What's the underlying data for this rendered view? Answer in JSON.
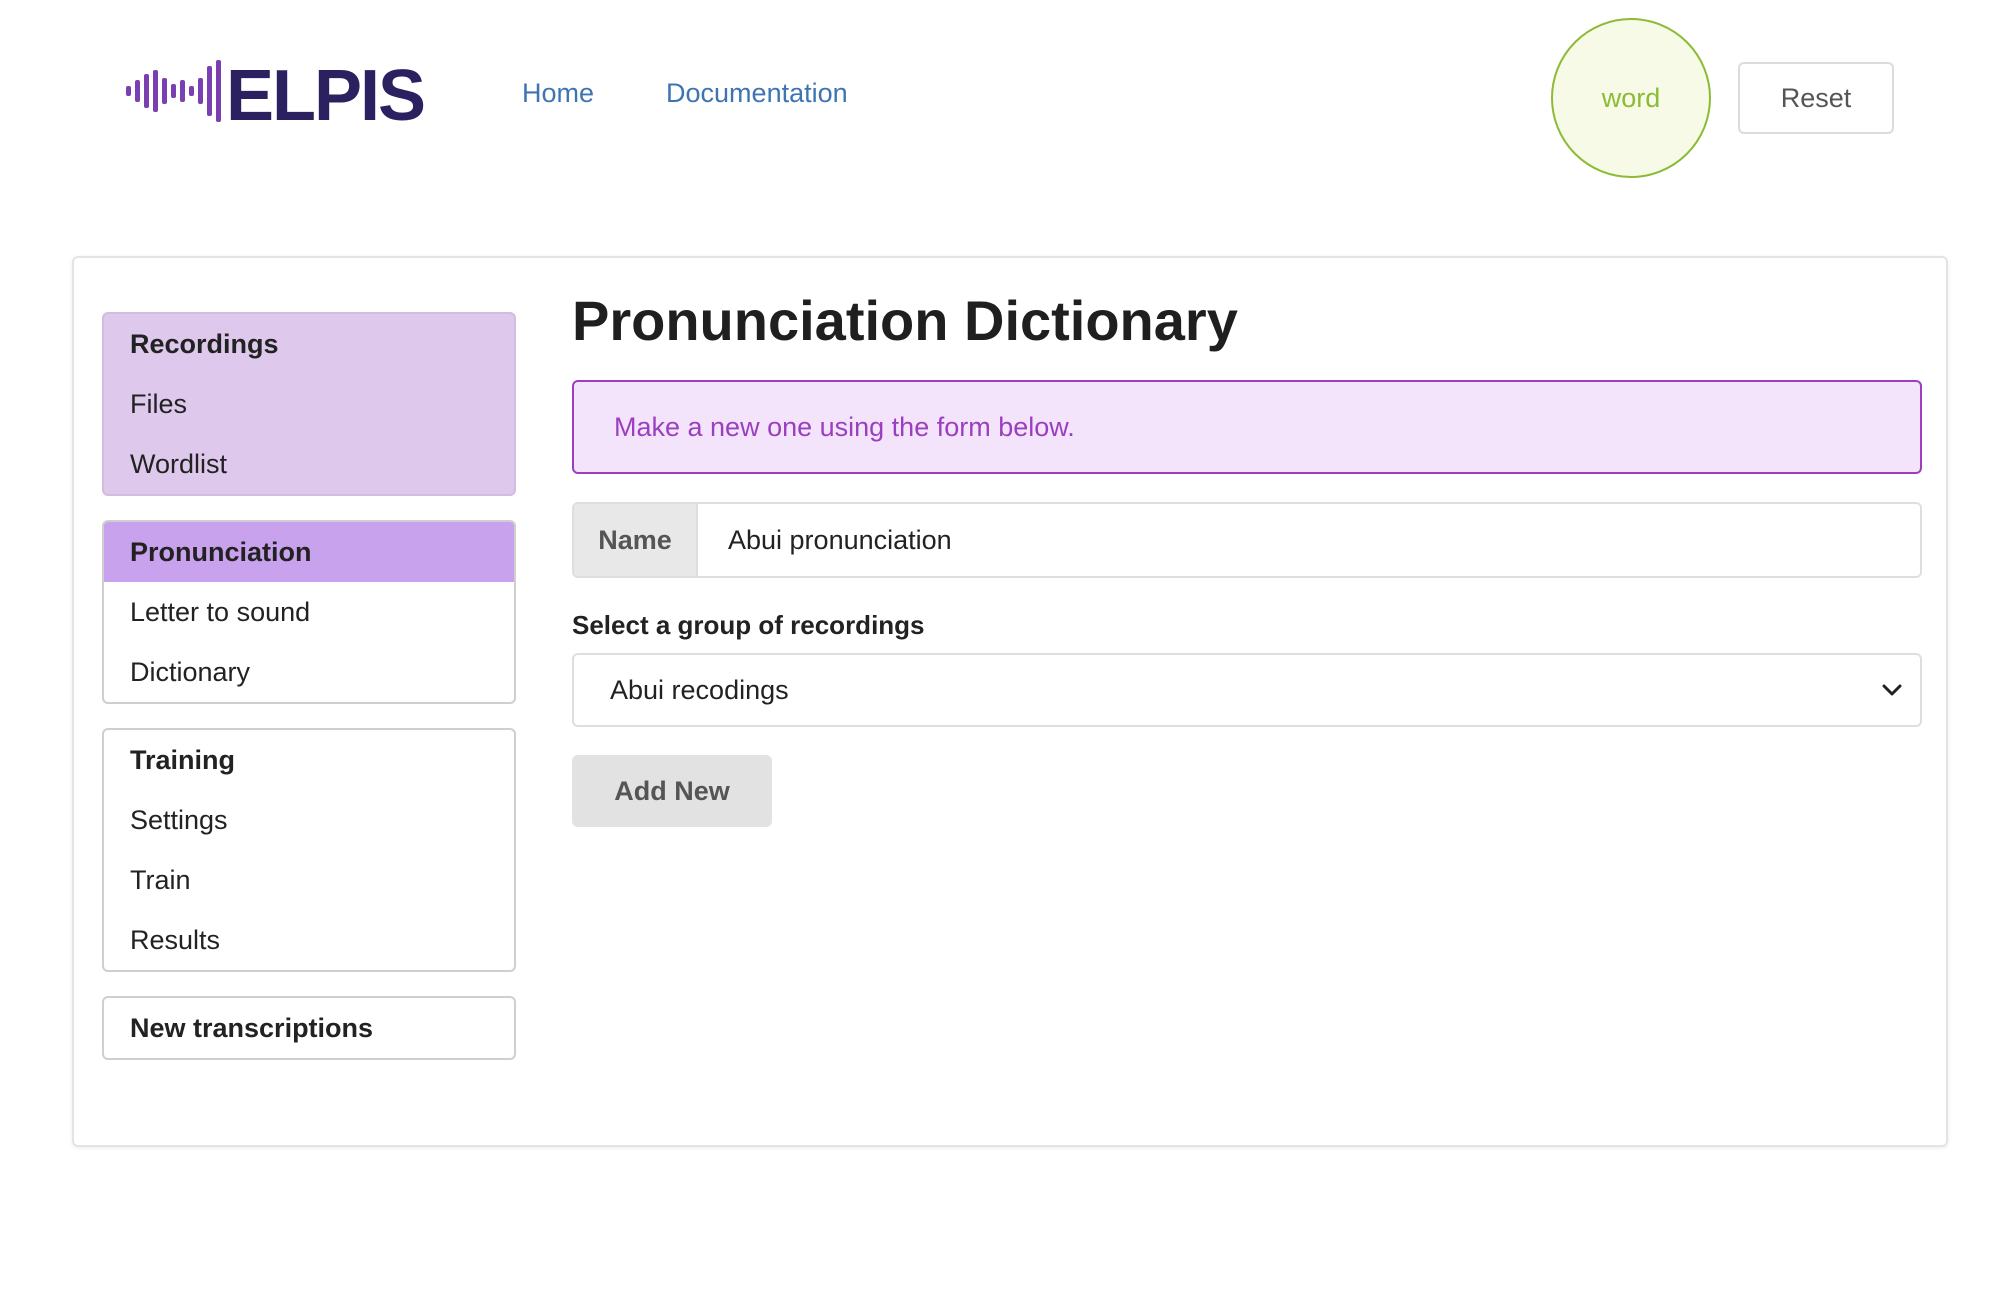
{
  "header": {
    "logo_text": "ELPIS",
    "nav": [
      {
        "label": "Home"
      },
      {
        "label": "Documentation"
      }
    ],
    "word_badge": "word",
    "reset_label": "Reset"
  },
  "sidebar": {
    "groups": [
      {
        "header": "Recordings",
        "items": [
          "Files",
          "Wordlist"
        ]
      },
      {
        "header": "Pronunciation",
        "items": [
          "Letter to sound",
          "Dictionary"
        ]
      },
      {
        "header": "Training",
        "items": [
          "Settings",
          "Train",
          "Results"
        ]
      },
      {
        "header": "New transcriptions",
        "items": []
      }
    ]
  },
  "main": {
    "title": "Pronunciation Dictionary",
    "info_message": "Make a new one using the form below.",
    "name_label": "Name",
    "name_value": "Abui pronunciation",
    "select_label": "Select a group of recordings",
    "select_value": "Abui recodings",
    "add_button": "Add New"
  },
  "colors": {
    "brand_purple": "#2b2160",
    "accent_purple": "#9b3fc0",
    "active_group_bg": "#dec9ed",
    "current_item_bg": "#c8a2ec",
    "link_blue": "#3f74b3",
    "word_green": "#8dbb35"
  },
  "icons": {
    "logo": "sound-wave-icon",
    "select": "chevron-down-icon"
  }
}
